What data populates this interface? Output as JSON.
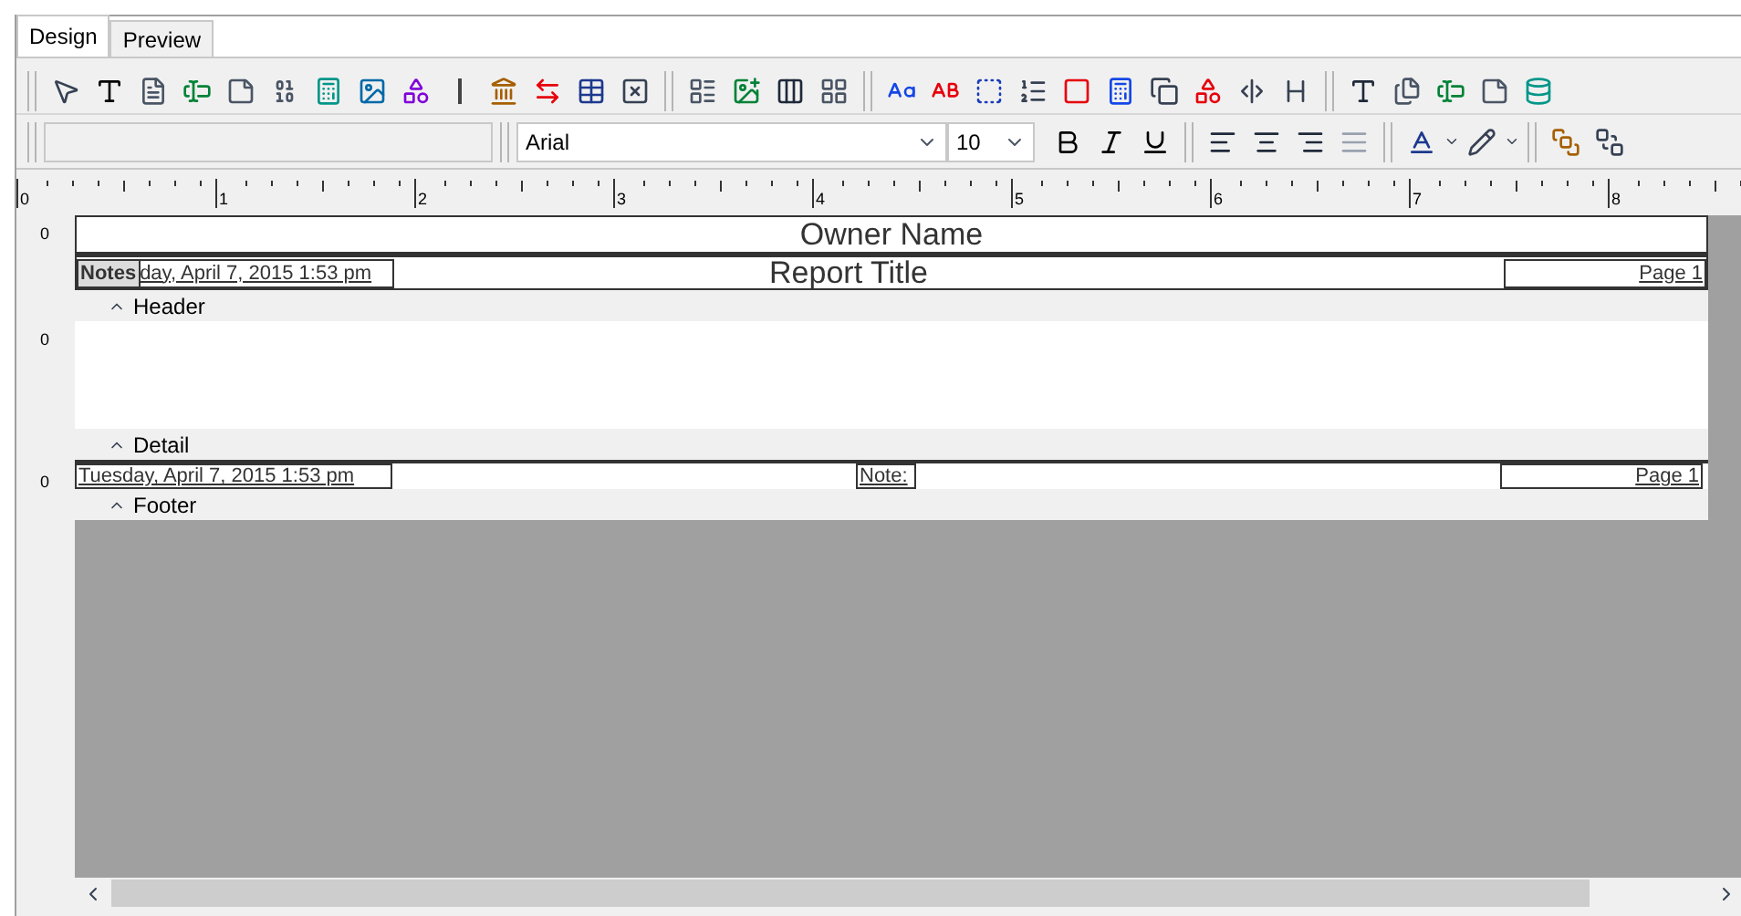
{
  "tabs": [
    {
      "label": "Design",
      "selected": true
    },
    {
      "label": "Preview",
      "selected": false
    }
  ],
  "format_bar": {
    "font": "Arial",
    "size": "10"
  },
  "ruler": [
    "0",
    "1",
    "2",
    "3",
    "4",
    "5",
    "6",
    "7",
    "8"
  ],
  "report": {
    "header": {
      "label": "Header",
      "ruler_mark": "0",
      "owner_name": "Owner Name",
      "title": "Report Title",
      "notes": "Notes",
      "date": "day, April 7, 2015  1:53 pm",
      "page": "Page 1"
    },
    "detail": {
      "label": "Detail",
      "ruler_mark": "0"
    },
    "footer": {
      "label": "Footer",
      "ruler_mark": "0",
      "date": "Tuesday, April 7, 2015  1:53 pm",
      "note": "Note:",
      "page": "Page 1"
    }
  }
}
